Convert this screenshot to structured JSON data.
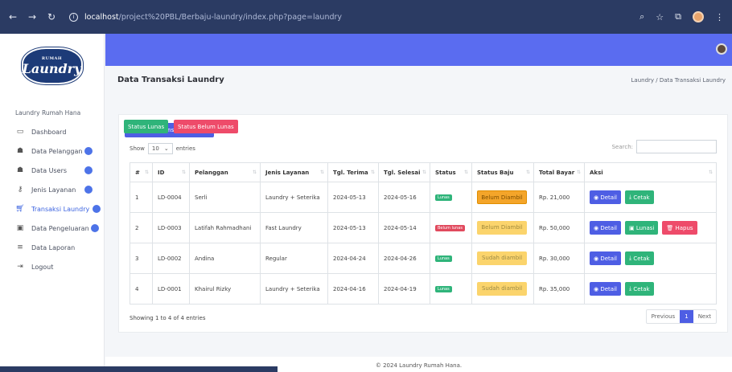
{
  "browser": {
    "url_host": "localhost",
    "url_path": "/project%20PBL/Berbaju-laundry/index.php?page=laundry"
  },
  "sidebar": {
    "logo_small": "RUMAH",
    "logo_text": "Laundry",
    "heading": "Laundry Rumah Hana",
    "items": [
      {
        "label": "Dashboard",
        "icon": "monitor-icon",
        "badge": false
      },
      {
        "label": "Data Pelanggan",
        "icon": "users-icon",
        "badge": true
      },
      {
        "label": "Data Users",
        "icon": "users-icon",
        "badge": true
      },
      {
        "label": "Jenis Layanan",
        "icon": "key-icon",
        "badge": true
      },
      {
        "label": "Transaksi Laundry",
        "icon": "cart-icon",
        "badge": true,
        "active": true
      },
      {
        "label": "Data Pengeluaran",
        "icon": "money-icon",
        "badge": true
      },
      {
        "label": "Data Laporan",
        "icon": "list-icon",
        "badge": false
      },
      {
        "label": "Logout",
        "icon": "logout-icon",
        "badge": false
      }
    ]
  },
  "page": {
    "title": "Data Transaksi Laundry",
    "breadcrumb": "Laundry  /  Data Transaksi Laundry"
  },
  "toolbar": {
    "add_label": "Tambah Transaksi Laundry",
    "filter_lunas": "Status Lunas",
    "filter_belum": "Status Belum Lunas",
    "show_label": "Show",
    "entries_value": "10",
    "entries_label": "entries",
    "search_label": "Search:"
  },
  "table": {
    "headers": [
      "#",
      "ID",
      "Pelanggan",
      "Jenis Layanan",
      "Tgl. Terima",
      "Tgl. Selesai",
      "Status",
      "Status Baju",
      "Total Bayar",
      "Aksi"
    ],
    "rows": [
      {
        "no": "1",
        "id": "LD-0004",
        "pelanggan": "Serli",
        "layanan": "Laundry + Seterika",
        "terima": "2024-05-13",
        "selesai": "2024-05-16",
        "status": "Lunas",
        "baju": "Belum Diambil",
        "total": "Rp. 21,000"
      },
      {
        "no": "2",
        "id": "LD-0003",
        "pelanggan": "Latifah Rahmadhani",
        "layanan": "Fast Laundry",
        "terima": "2024-05-13",
        "selesai": "2024-05-14",
        "status": "Belum lunas",
        "baju": "Belum Diambil",
        "total": "Rp. 50,000"
      },
      {
        "no": "3",
        "id": "LD-0002",
        "pelanggan": "Andina",
        "layanan": "Regular",
        "terima": "2024-04-24",
        "selesai": "2024-04-26",
        "status": "Lunas",
        "baju": "Sudah diambil",
        "total": "Rp. 30,000"
      },
      {
        "no": "4",
        "id": "LD-0001",
        "pelanggan": "Khairul Rizky",
        "layanan": "Laundry + Seterika",
        "terima": "2024-04-16",
        "selesai": "2024-04-19",
        "status": "Lunas",
        "baju": "Sudah diambil",
        "total": "Rp. 35,000"
      }
    ],
    "action_detail": "Detail",
    "action_cetak": "Cetak",
    "action_lunasi": "Lunasi",
    "action_hapus": "Hapus"
  },
  "footer_table": {
    "showing": "Showing 1 to 4 of 4 entries",
    "prev": "Previous",
    "page": "1",
    "next": "Next"
  },
  "footer": "© 2024 Laundry Rumah Hana."
}
